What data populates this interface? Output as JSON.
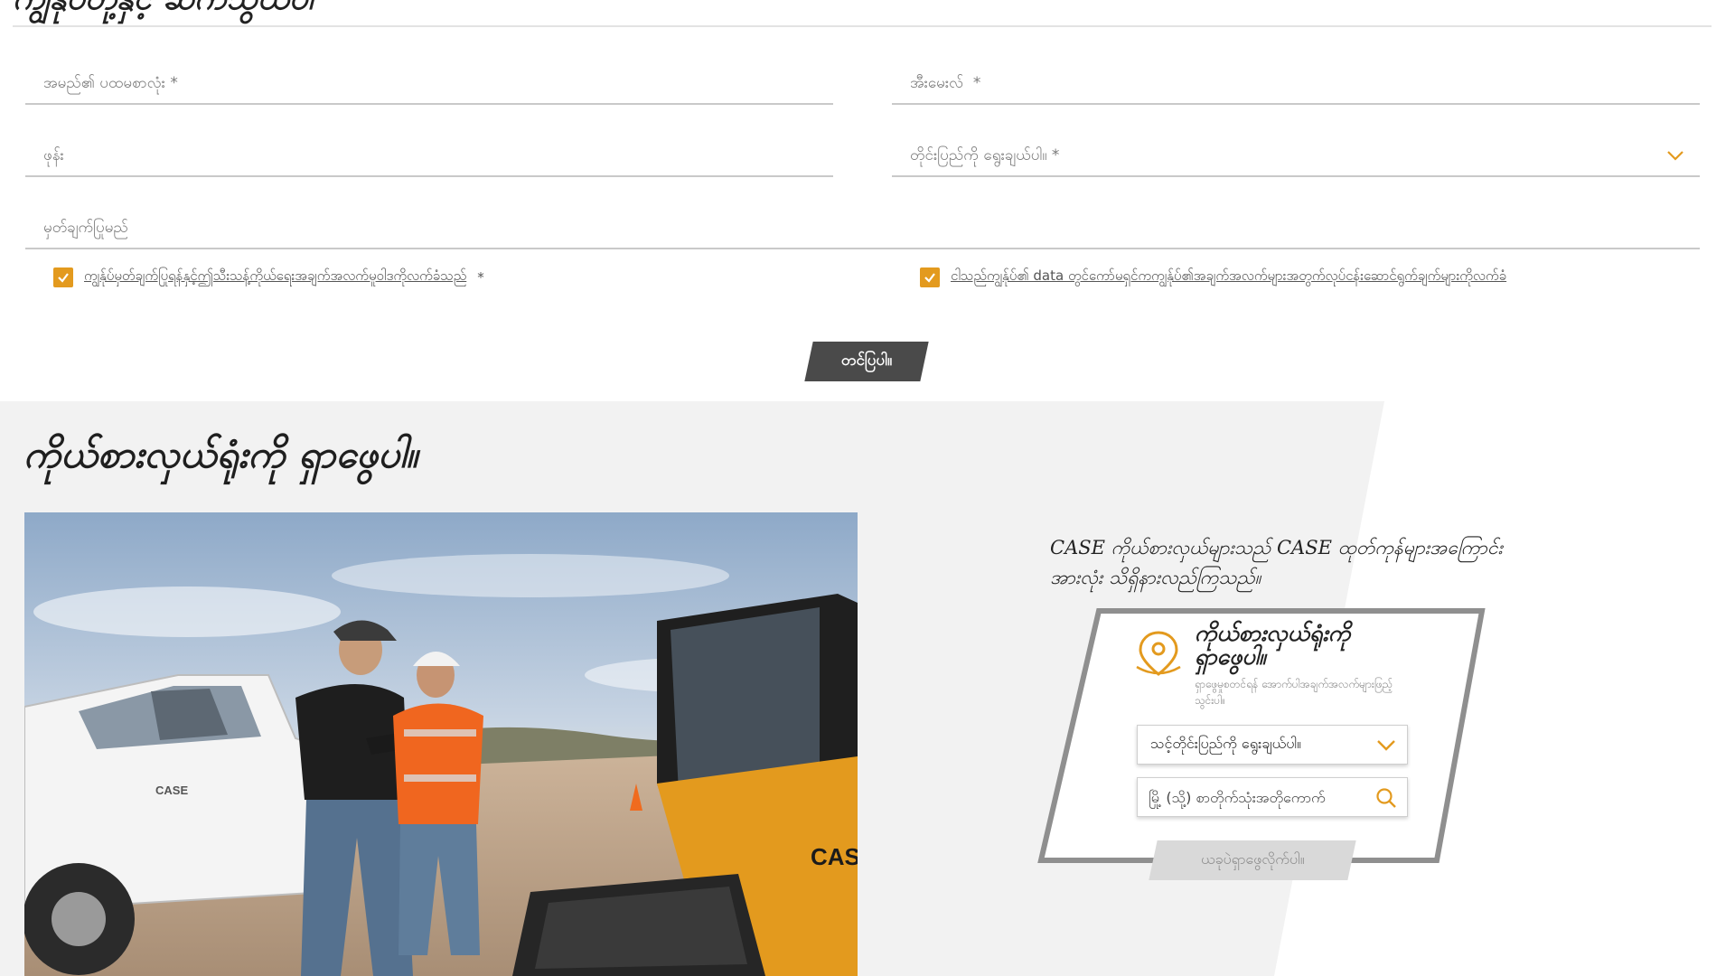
{
  "contact_form": {
    "heading": "ကျွန်ုပ်တို့နှင့် ဆက်သွယ်ပါ",
    "fields": {
      "first_name_placeholder": "အမည်၏ ပထမစာလုံး *",
      "email_placeholder": "အီးမေးလ်  *",
      "phone_placeholder": "ဖုန်း",
      "country_placeholder": "တိုင်းပြည်ကို ရွေးချယ်ပါ။ *",
      "comment_placeholder": "မှတ်ချက်ပြုမည်"
    },
    "consent_privacy": {
      "label": "ကျွန်ုပ်မှတ်ချက်ပြုရန်နှင့်ဤသီးသန့်ကိုယ်ရေးအချက်အလက်မူဝါဒကိုလက်ခံသည်",
      "required_mark": "*",
      "checked": true
    },
    "consent_marketing": {
      "label": "ငါသည်ကျွန်ုပ်၏ data တွင်ကော်မရှင်ကကျွန်ုပ်၏အချက်အလက်များအတွက်လုပ်ငန်းဆောင်ရွက်ချက်များကိုလက်ခံ",
      "checked": true
    },
    "submit_label": "တင်ပြပါ။"
  },
  "dealer_locator": {
    "title": "ကိုယ်စားလှယ်ရုံးကို ရှာဖွေပါ။",
    "description": "CASE ကိုယ်စားလှယ်များသည် CASE ထုတ်ကုန်များအကြောင်း အားလုံး သိရှိနားလည်ကြသည်။",
    "widget": {
      "title": "ကိုယ်စားလှယ်ရုံးကို ရှာဖွေပါ။",
      "subtitle": "ရှာဖွေမှုစတင်ရန် အောက်ပါအချက်အလက်များဖြည့်သွင်းပါ။",
      "country_select_value": "သင့်တိုင်းပြည်ကို ရွေးချယ်ပါ။",
      "city_placeholder": "မြို့ (သို့) စာတိုက်သုံးအတိုကောက်",
      "find_button_label": "ယခုပဲရှာဖွေလိုက်ပါ။",
      "pin_icon": "location-pin-icon",
      "search_icon": "search-icon"
    },
    "photo": {
      "truck_badge_text": "CASE",
      "machine_badge_text": "CASE"
    }
  },
  "colors": {
    "accent": "#e39a1e",
    "button_dark": "#4a4a4a",
    "section_bg": "#f2f2f2",
    "frame_border": "#8f8f8f",
    "button_disabled": "#d9d9d9"
  }
}
